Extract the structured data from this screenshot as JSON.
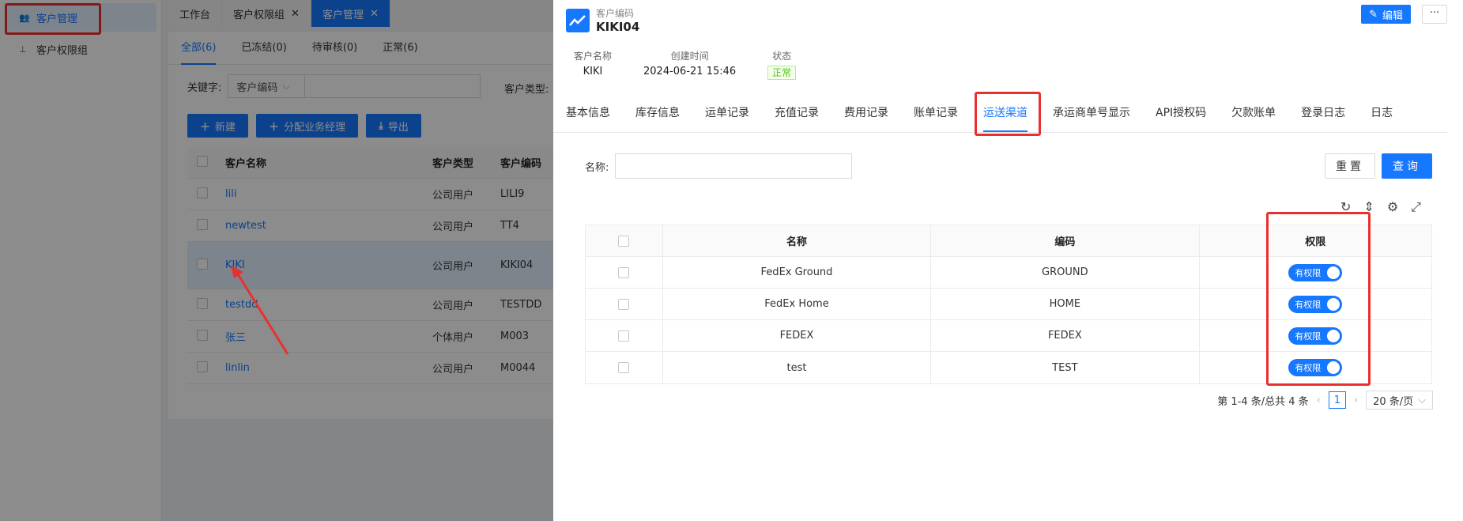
{
  "sidebar": {
    "items": [
      {
        "label": "客户管理",
        "icon": "users-icon"
      },
      {
        "label": "客户权限组",
        "icon": "sitemap-icon"
      }
    ]
  },
  "window_tabs": [
    {
      "label": "工作台"
    },
    {
      "label": "客户权限组",
      "close": "✕"
    },
    {
      "label": "客户管理",
      "close": "✕"
    }
  ],
  "list": {
    "status_tabs": [
      "全部(6)",
      "已冻结(0)",
      "待审核(0)",
      "正常(6)"
    ],
    "keyword_label": "关键字:",
    "keyword_select": "客户编码",
    "customer_type_label": "客户类型:",
    "buttons": [
      "新建",
      "分配业务经理",
      "导出"
    ],
    "columns": [
      "客户名称",
      "客户类型",
      "客户编码"
    ],
    "rows": [
      [
        "lili",
        "公司用户",
        "LILI9"
      ],
      [
        "newtest",
        "公司用户",
        "TT4"
      ],
      [
        "KIKI",
        "公司用户",
        "KIKI04"
      ],
      [
        "testdd",
        "公司用户",
        "TESTDD"
      ],
      [
        "张三",
        "个体用户",
        "M003"
      ],
      [
        "linlin",
        "公司用户",
        "M0044"
      ]
    ]
  },
  "drawer": {
    "code_label": "客户编码",
    "code": "KIKI04",
    "edit_label": "编辑",
    "more_label": "···",
    "meta": [
      {
        "k": "客户名称",
        "v": "KIKI"
      },
      {
        "k": "创建时间",
        "v": "2024-06-21 15:46"
      },
      {
        "k": "状态",
        "v": "正常"
      }
    ],
    "tabs": [
      "基本信息",
      "库存信息",
      "运单记录",
      "充值记录",
      "费用记录",
      "账单记录",
      "运送渠道",
      "承运商单号显示",
      "API授权码",
      "欠款账单",
      "登录日志",
      "日志"
    ],
    "name_label": "名称:",
    "reset_label": "重置",
    "query_label": "查询",
    "columns": [
      "名称",
      "编码",
      "权限"
    ],
    "rows": [
      [
        "FedEx Ground",
        "GROUND",
        "有权限"
      ],
      [
        "FedEx Home",
        "HOME",
        "有权限"
      ],
      [
        "FEDEX",
        "FEDEX",
        "有权限"
      ],
      [
        "test",
        "TEST",
        "有权限"
      ]
    ],
    "pager": {
      "summary": "第 1-4 条/总共 4 条",
      "page": "1",
      "size": "20 条/页"
    }
  },
  "colors": {
    "accent": "#1677ff",
    "highlight": "#e8312f"
  }
}
